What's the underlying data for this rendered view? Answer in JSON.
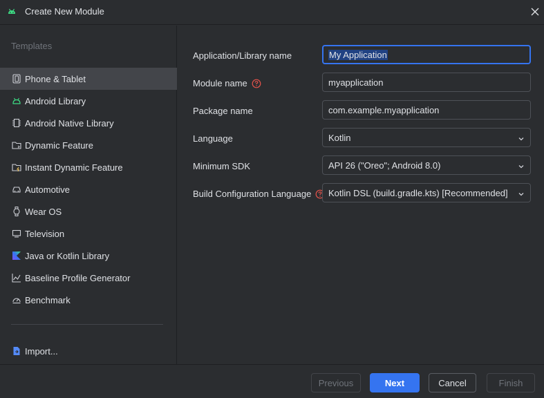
{
  "window": {
    "title": "Create New Module",
    "icon": "android-icon",
    "close_icon": "close-icon"
  },
  "sidebar": {
    "section_title": "Templates",
    "items": [
      {
        "label": "Phone & Tablet",
        "icon": "phone-tablet-icon",
        "selected": true
      },
      {
        "label": "Android Library",
        "icon": "android-icon"
      },
      {
        "label": "Android Native Library",
        "icon": "native-library-icon"
      },
      {
        "label": "Dynamic Feature",
        "icon": "dynamic-feature-icon"
      },
      {
        "label": "Instant Dynamic Feature",
        "icon": "instant-feature-icon"
      },
      {
        "label": "Automotive",
        "icon": "car-icon"
      },
      {
        "label": "Wear OS",
        "icon": "watch-icon"
      },
      {
        "label": "Television",
        "icon": "tv-icon"
      },
      {
        "label": "Java or Kotlin Library",
        "icon": "kotlin-icon"
      },
      {
        "label": "Baseline Profile Generator",
        "icon": "baseline-chart-icon"
      },
      {
        "label": "Benchmark",
        "icon": "gauge-icon"
      }
    ],
    "import_label": "Import..."
  },
  "form": {
    "app_name": {
      "label": "Application/Library name",
      "value": "My Application"
    },
    "module_name": {
      "label": "Module name",
      "value": "myapplication"
    },
    "package_name": {
      "label": "Package name",
      "value": "com.example.myapplication"
    },
    "language": {
      "label": "Language",
      "value": "Kotlin"
    },
    "min_sdk": {
      "label": "Minimum SDK",
      "value": "API 26 (\"Oreo\"; Android 8.0)"
    },
    "build_config": {
      "label": "Build Configuration Language",
      "value": "Kotlin DSL (build.gradle.kts) [Recommended]"
    }
  },
  "footer": {
    "previous": "Previous",
    "next": "Next",
    "cancel": "Cancel",
    "finish": "Finish"
  },
  "colors": {
    "accent": "#3574f0",
    "background": "#2b2d30",
    "android_green": "#3ddc84",
    "help_red": "#e5534b"
  }
}
